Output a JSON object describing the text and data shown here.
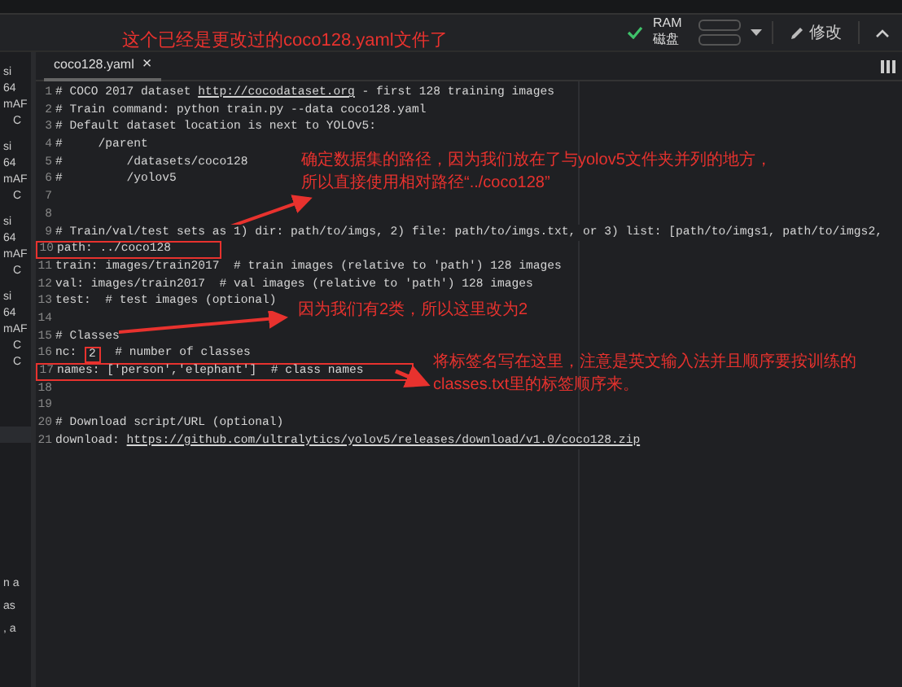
{
  "toolbar": {
    "ram_label": "RAM",
    "disk_label": "磁盘",
    "edit_button": "修改"
  },
  "left_panel": {
    "groups": [
      [
        "si",
        "64",
        "mAF",
        "C"
      ],
      [
        "si",
        "64",
        "mAF",
        "C"
      ],
      [
        "si",
        "64",
        "mAF",
        "C"
      ],
      [
        "si",
        "64",
        "mAF",
        "C",
        "C"
      ]
    ],
    "bottom": [
      "n a",
      "as",
      ", a"
    ]
  },
  "tabs": [
    {
      "label": "coco128.yaml",
      "close": "×",
      "selected": true
    }
  ],
  "editor": {
    "lines": [
      {
        "num": "1",
        "boxed": false,
        "segments": [
          {
            "kind": "plain",
            "text": "# COCO 2017 dataset "
          },
          {
            "kind": "link",
            "text": "http://cocodataset.org"
          },
          {
            "kind": "plain",
            "text": " - first 128 training images"
          }
        ]
      },
      {
        "num": "2",
        "boxed": false,
        "segments": [
          {
            "kind": "plain",
            "text": "# Train command: python train.py --data coco128.yaml"
          }
        ]
      },
      {
        "num": "3",
        "boxed": false,
        "segments": [
          {
            "kind": "plain",
            "text": "# Default dataset location is next to YOLOv5:"
          }
        ]
      },
      {
        "num": "4",
        "boxed": false,
        "segments": [
          {
            "kind": "plain",
            "text": "#     /parent"
          }
        ]
      },
      {
        "num": "5",
        "boxed": false,
        "segments": [
          {
            "kind": "plain",
            "text": "#         /datasets/coco128"
          }
        ]
      },
      {
        "num": "6",
        "boxed": false,
        "segments": [
          {
            "kind": "plain",
            "text": "#         /yolov5"
          }
        ]
      },
      {
        "num": "7",
        "boxed": false
      },
      {
        "num": "8",
        "boxed": false
      },
      {
        "num": "9",
        "boxed": false,
        "segments": [
          {
            "kind": "plain",
            "text": "# Train/val/test sets as 1) dir: path/to/imgs, 2) file: path/to/imgs.txt, or 3) list: [path/to/imgs1, path/to/imgs2,"
          }
        ]
      },
      {
        "num": "10",
        "boxed": true,
        "segments": [
          {
            "kind": "plain",
            "text": "path: ../coco128"
          }
        ]
      },
      {
        "num": "11",
        "boxed": false,
        "segments": [
          {
            "kind": "plain",
            "text": "train: images/train2017  # train images (relative to 'path') 128 images"
          }
        ]
      },
      {
        "num": "12",
        "boxed": false,
        "segments": [
          {
            "kind": "plain",
            "text": "val: images/train2017  # val images (relative to 'path') 128 images"
          }
        ]
      },
      {
        "num": "13",
        "boxed": false,
        "segments": [
          {
            "kind": "plain",
            "text": "test:  # test images (optional)"
          }
        ]
      },
      {
        "num": "14",
        "boxed": false
      },
      {
        "num": "15",
        "boxed": false,
        "segments": [
          {
            "kind": "plain",
            "text": "# Classes"
          }
        ]
      },
      {
        "num": "16",
        "boxed": false,
        "segments": [
          {
            "kind": "plain",
            "text": "nc: "
          },
          {
            "kind": "boxed",
            "text": "2"
          },
          {
            "kind": "plain",
            "text": "  # number of classes"
          }
        ]
      },
      {
        "num": "17",
        "boxed": true,
        "segments": [
          {
            "kind": "plain",
            "text": "names: ['person','elephant']  # class names"
          }
        ]
      },
      {
        "num": "18",
        "boxed": false
      },
      {
        "num": "19",
        "boxed": false
      },
      {
        "num": "20",
        "boxed": false,
        "segments": [
          {
            "kind": "plain",
            "text": "# Download script/URL (optional)"
          }
        ]
      },
      {
        "num": "21",
        "boxed": false,
        "segments": [
          {
            "kind": "plain",
            "text": "download: "
          },
          {
            "kind": "link",
            "text": "https://github.com/ultralytics/yolov5/releases/download/v1.0/coco128.zip"
          }
        ]
      }
    ]
  },
  "annotations": {
    "title": "这个已经是更改过的coco128.yaml文件了",
    "notes": [
      {
        "text": "确定数据集的路径，因为我们放在了与yolov5文件夹并列的地方，所以直接使用相对路径“../coco128”"
      },
      {
        "text": "因为我们有2类，所以这里改为2"
      },
      {
        "text": "将标签名写在这里，注意是英文输入法并且顺序要按训练的classes.txt里的标签顺序来。"
      }
    ]
  }
}
